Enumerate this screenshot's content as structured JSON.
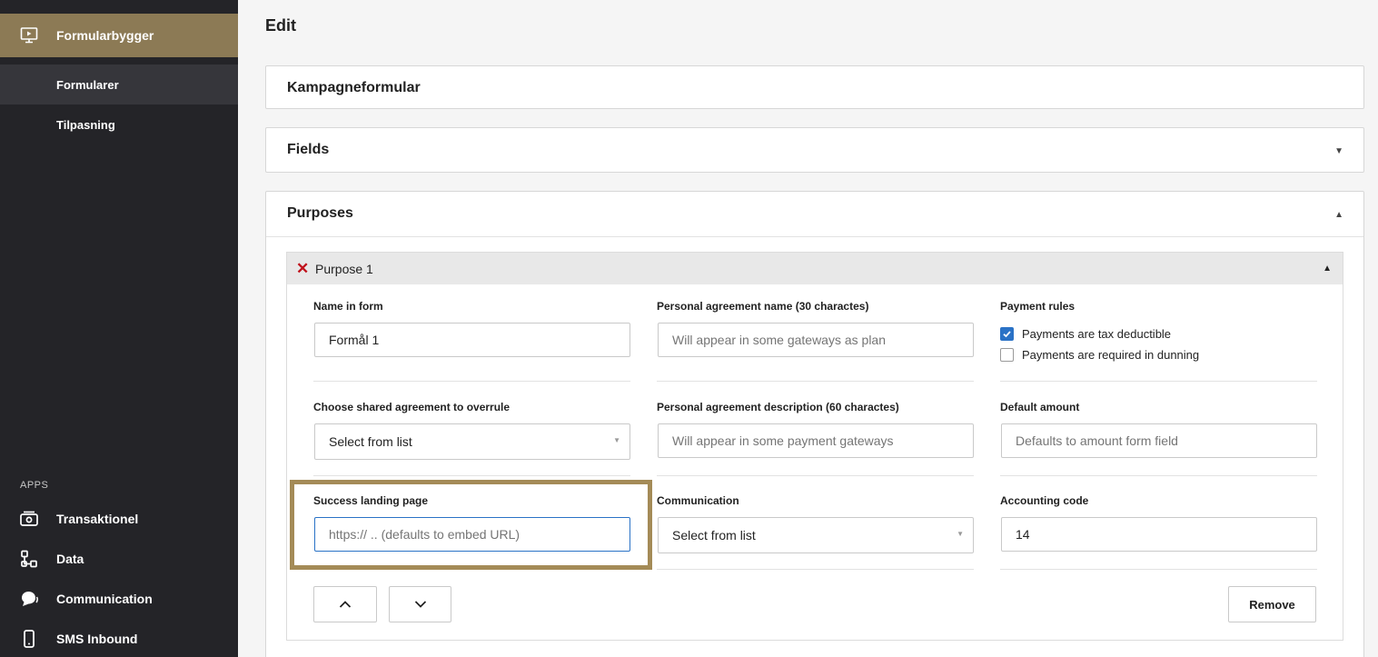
{
  "sidebar": {
    "active_item": "Formularbygger",
    "sub_items": [
      "Formularer",
      "Tilpasning"
    ],
    "apps_heading": "APPS",
    "apps": [
      {
        "label": "Transaktionel",
        "icon": "cash-icon"
      },
      {
        "label": "Data",
        "icon": "data-icon"
      },
      {
        "label": "Communication",
        "icon": "chat-icon"
      },
      {
        "label": "SMS Inbound",
        "icon": "phone-icon"
      }
    ]
  },
  "page": {
    "title": "Edit",
    "form_name": "Kampagneformular",
    "fields_section": "Fields",
    "purposes_section": "Purposes"
  },
  "purpose": {
    "title": "Purpose 1",
    "name_in_form": {
      "label": "Name in form",
      "value": "Formål 1"
    },
    "personal_agreement_name": {
      "label": "Personal agreement name (30 charactes)",
      "placeholder": "Will appear in some gateways as plan"
    },
    "payment_rules": {
      "label": "Payment rules",
      "options": [
        {
          "label": "Payments are tax deductible",
          "checked": true
        },
        {
          "label": "Payments are required in dunning",
          "checked": false
        }
      ]
    },
    "shared_agreement": {
      "label": "Choose shared agreement to overrule",
      "value": "Select from list"
    },
    "personal_agreement_description": {
      "label": "Personal agreement description (60 charactes)",
      "placeholder": "Will appear in some payment gateways"
    },
    "default_amount": {
      "label": "Default amount",
      "placeholder": "Defaults to amount form field"
    },
    "success_landing_page": {
      "label": "Success landing page",
      "placeholder": "https:// .. (defaults to embed URL)"
    },
    "communication": {
      "label": "Communication",
      "value": "Select from list"
    },
    "accounting_code": {
      "label": "Accounting code",
      "value": "14"
    },
    "remove_label": "Remove"
  },
  "colors": {
    "sidebar_bg": "#242428",
    "sidebar_active": "#8c7a55",
    "highlight": "#a48b57",
    "checkbox_on": "#2a72c6",
    "remove_x": "#c0121b"
  }
}
